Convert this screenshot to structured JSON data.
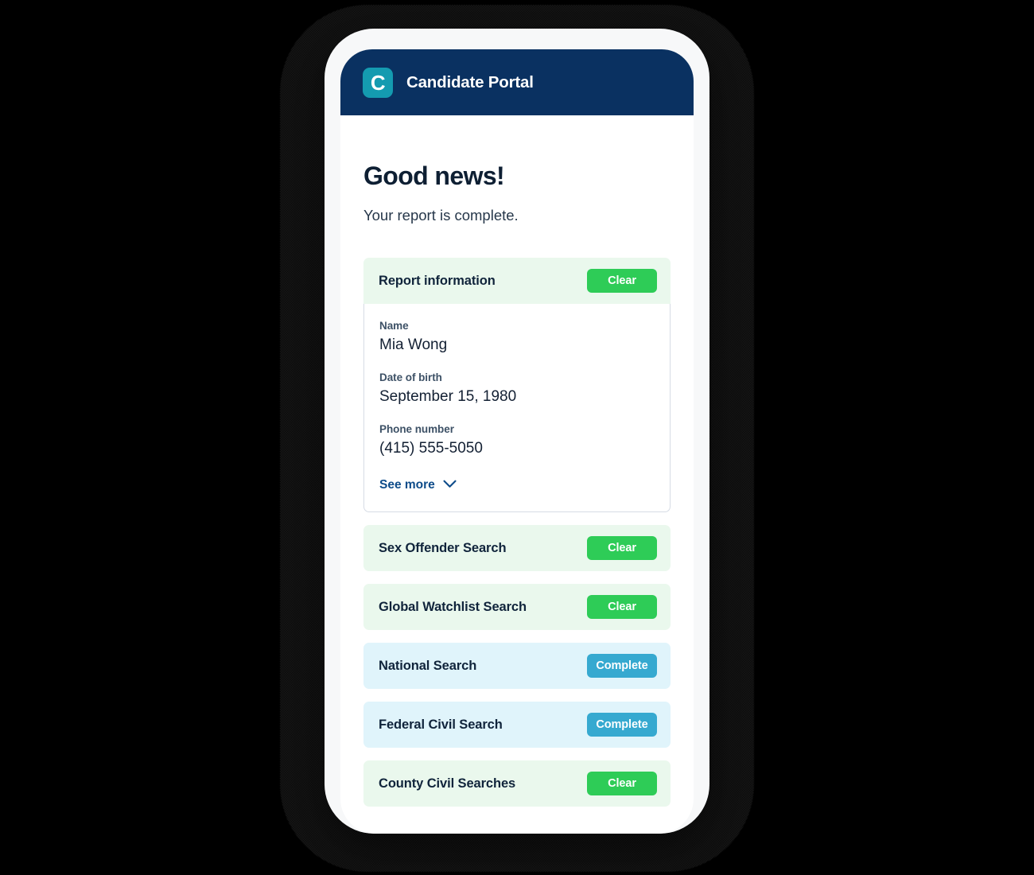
{
  "app": {
    "title": "Candidate Portal",
    "logo_letter": "C",
    "logo_icon": "candidate-logo-icon",
    "header_bg": "#0a3161",
    "logo_bg": "#149bb0"
  },
  "page": {
    "heading": "Good news!",
    "subheading": "Your report is complete."
  },
  "report_card": {
    "title": "Report information",
    "status_label": "Clear",
    "status_color": "#2ecc57",
    "fields": [
      {
        "label": "Name",
        "value": "Mia Wong"
      },
      {
        "label": "Date of birth",
        "value": "September 15, 1980"
      },
      {
        "label": "Phone number",
        "value": "(415) 555-5050"
      }
    ],
    "see_more_label": "See more",
    "see_more_icon": "chevron-down-icon"
  },
  "searches": [
    {
      "label": "Sex Offender Search",
      "status": "Clear",
      "tone": "green"
    },
    {
      "label": "Global Watchlist Search",
      "status": "Clear",
      "tone": "green"
    },
    {
      "label": "National Search",
      "status": "Complete",
      "tone": "blue"
    },
    {
      "label": "Federal Civil Search",
      "status": "Complete",
      "tone": "blue"
    },
    {
      "label": "County Civil Searches",
      "status": "Clear",
      "tone": "green"
    }
  ],
  "colors": {
    "clear_badge": "#2ecc57",
    "complete_badge": "#36a9d0",
    "row_green": "#eaf8ed",
    "row_blue": "#e0f4fb",
    "navy": "#0a3161",
    "link": "#0e4c8a"
  }
}
